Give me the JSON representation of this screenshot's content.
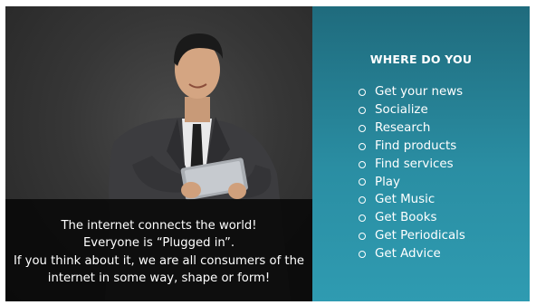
{
  "caption": {
    "line1": "The internet connects the world!",
    "line2": "Everyone is “Plugged in”.",
    "line3": "If you think about it, we are all consumers of the",
    "line4": "internet in some way, shape or form!"
  },
  "info": {
    "title": "WHERE DO YOU",
    "items": [
      "Get your news",
      "Socialize",
      "Research",
      "Find products",
      "Find services",
      "Play",
      "Get Music",
      "Get Books",
      "Get Periodicals",
      "Get Advice"
    ]
  },
  "photo": {
    "subject": "man-in-suit-holding-tablet"
  },
  "colors": {
    "panel_teal": "#2a8ea3",
    "caption_band": "#080808"
  }
}
